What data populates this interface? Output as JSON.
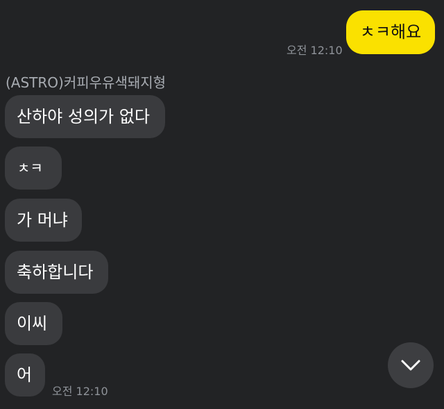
{
  "messages_outgoing": [
    {
      "text": "ㅊㅋ해요",
      "time": "오전 12:10"
    }
  ],
  "incoming": {
    "sender": "(ASTRO)커피우유색돼지형",
    "messages": [
      "산하야 성의가 없다",
      "ㅊㅋ",
      "가 머냐",
      "축하합니다",
      "이씨",
      "어"
    ],
    "time": "오전 12:10"
  },
  "controls": {
    "scroll_down_icon": "chevron-down-icon"
  },
  "colors": {
    "background": "#222325",
    "outgoing_bubble": "#fae100",
    "incoming_bubble": "#3a3b3e",
    "timestamp": "#8f9399"
  }
}
